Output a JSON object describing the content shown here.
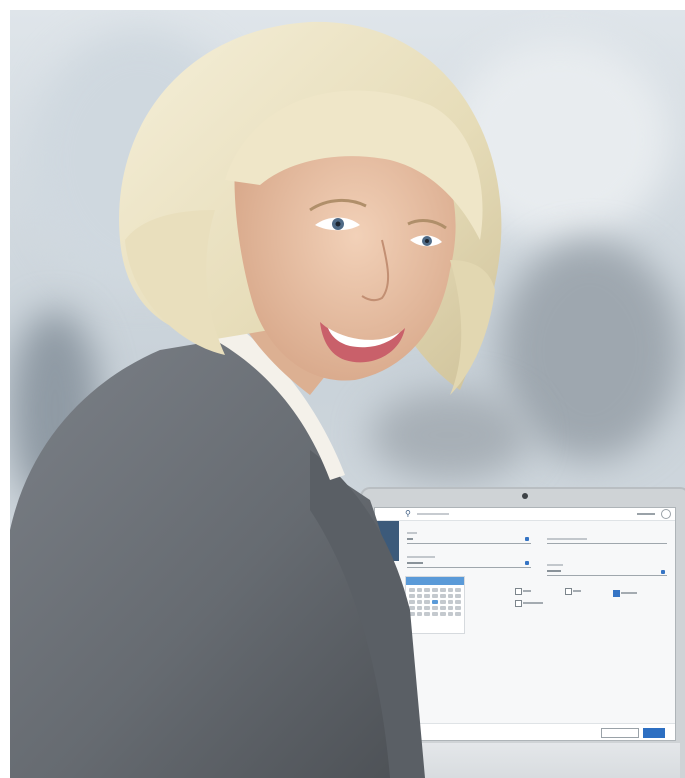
{
  "scene": {
    "description_colors": {
      "background": "#d3dae0",
      "hair": "#ebe3c4",
      "skin": "#e9c2a6",
      "jacket": "#6d7278",
      "blouse": "#f4f1ea",
      "laptop": "#cfd3d6",
      "app_accent": "#3574c4"
    }
  },
  "laptop_app": {
    "accent": "#3574c4",
    "icons": [
      "search-icon",
      "settings-icon"
    ]
  }
}
